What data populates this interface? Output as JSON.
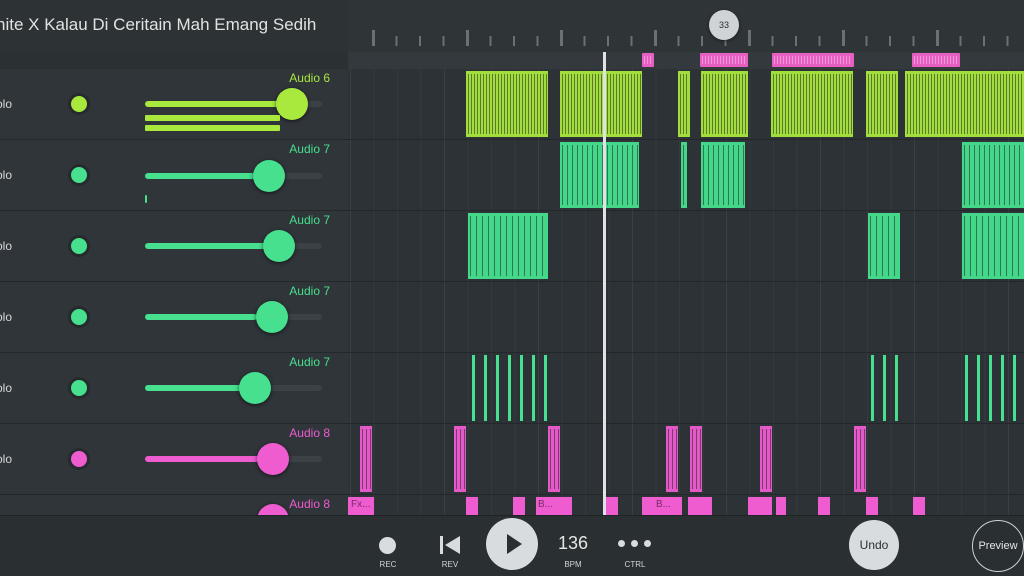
{
  "header": {
    "song_title": "nite X Kalau Di Ceritain Mah Emang Sedih"
  },
  "ruler": {
    "playhead_bar": "33"
  },
  "colors": {
    "lime": "#a9e83c",
    "green": "#46e08e",
    "pink": "#ee5cd0"
  },
  "tracks": [
    {
      "solo_label": "olo",
      "name": "Audio 6",
      "color": "lime",
      "volume": 0.82
    },
    {
      "solo_label": "olo",
      "name": "Audio 7",
      "color": "green",
      "volume": 0.7
    },
    {
      "solo_label": "olo",
      "name": "Audio 7",
      "color": "green",
      "volume": 0.76
    },
    {
      "solo_label": "olo",
      "name": "Audio 7",
      "color": "green",
      "volume": 0.71
    },
    {
      "solo_label": "olo",
      "name": "Audio 7",
      "color": "green",
      "volume": 0.62
    },
    {
      "solo_label": "olo",
      "name": "Audio 8",
      "color": "pink",
      "volume": 0.72
    },
    {
      "solo_label": "",
      "name": "Audio 8",
      "color": "pink",
      "volume": 0.72
    }
  ],
  "clips": {
    "lane6_labels": [
      "Fx...",
      "B...",
      "B..."
    ]
  },
  "toolbar": {
    "rec_label": "REC",
    "rev_label": "REV",
    "bpm_value": "136",
    "bpm_label": "BPM",
    "ctrl_label": "CTRL",
    "undo_label": "Undo",
    "preview_label": "Preview"
  }
}
